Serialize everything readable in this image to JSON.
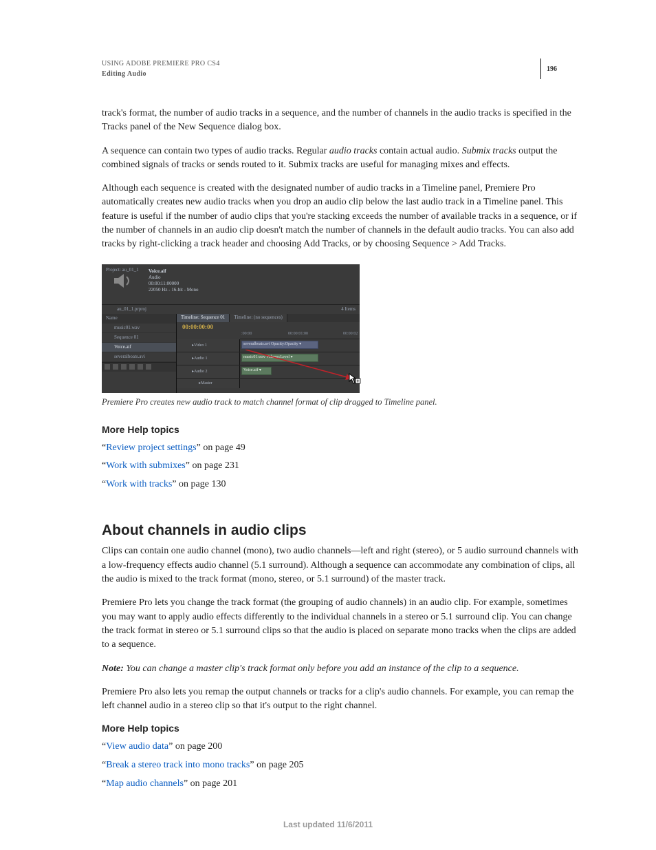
{
  "header": {
    "book_title": "USING ADOBE PREMIERE PRO CS4",
    "chapter": "Editing Audio",
    "page_number": "196"
  },
  "paragraphs": {
    "p1": "track's format, the number of audio tracks in a sequence, and the number of channels in the audio tracks is specified in the Tracks panel of the New Sequence dialog box.",
    "p2a": "A sequence can contain two types of audio tracks. Regular ",
    "p2b_i": "audio tracks",
    "p2c": " contain actual audio. ",
    "p2d_i": "Submix tracks",
    "p2e": " output the combined signals of tracks or sends routed to it. Submix tracks are useful for managing mixes and effects.",
    "p3": "Although each sequence is created with the designated number of audio tracks in a Timeline panel, Premiere Pro automatically creates new audio tracks when you drop an audio clip below the last audio track in a Timeline panel. This feature is useful if the number of audio clips that you're stacking exceeds the number of available tracks in a sequence, or if the number of channels in an audio clip doesn't match the number of channels in the default audio tracks. You can also add tracks by right-clicking a track header and choosing Add Tracks, or by choosing Sequence > Add Tracks."
  },
  "screenshot": {
    "project_label": "Project: au_01_1",
    "clip_name": "Voice.aif",
    "clip_kind": "Audio",
    "clip_duration": "00:00:11:00000",
    "clip_audio": "22050 Hz - 16-bit - Mono",
    "bin_label": "au_01_1.prproj",
    "items_label": "4 Items",
    "col_name": "Name",
    "rows": [
      "music01.wav",
      "Sequence 01",
      "Voice.aif",
      "severalboats.avi"
    ],
    "tab_seq": "Timeline: Sequence 01",
    "tab_no": "Timeline: (no sequences)",
    "timecode": "00:00:00:00",
    "tick0": ":00:00",
    "tick1": "00:00:01:00",
    "tick2": "00:00:02",
    "video1": "Video 1",
    "audio1": "Audio 1",
    "audio2": "Audio 2",
    "master": "Master",
    "clip_v": "severalboats.avi Opacity:Opacity ▾",
    "clip_a1": "music01.wav Volume:Level ▾",
    "clip_a2": "Voice.aif ▾"
  },
  "caption": "Premiere Pro creates new audio track to match channel format of clip dragged to Timeline panel.",
  "help1": {
    "heading": "More Help topics",
    "items": [
      {
        "q": "“",
        "link": "Review project settings",
        "tail": "” on page 49"
      },
      {
        "q": "“",
        "link": "Work with submixes",
        "tail": "” on page 231"
      },
      {
        "q": "“",
        "link": "Work with tracks",
        "tail": "” on page 130"
      }
    ]
  },
  "section2": {
    "heading": "About channels in audio clips",
    "p1": "Clips can contain one audio channel (mono), two audio channels—left and right (stereo), or 5 audio surround channels with a low-frequency effects audio channel (5.1 surround). Although a sequence can accommodate any combination of clips, all the audio is mixed to the track format (mono, stereo, or 5.1 surround) of the master track.",
    "p2": "Premiere Pro lets you change the track format (the grouping of audio channels) in an audio clip. For example, sometimes you may want to apply audio effects differently to the individual channels in a stereo or 5.1 surround clip. You can change the track format in stereo or 5.1 surround clips so that the audio is placed on separate mono tracks when the clips are added to a sequence.",
    "note_lead": "Note:",
    "note_body": " You can change a master clip's track format only before you add an instance of the clip to a sequence.",
    "p3": "Premiere Pro also lets you remap the output channels or tracks for a clip's audio channels. For example, you can remap the left channel audio in a stereo clip so that it's output to the right channel."
  },
  "help2": {
    "heading": "More Help topics",
    "items": [
      {
        "q": "“",
        "link": "View audio data",
        "tail": "” on page 200"
      },
      {
        "q": "“",
        "link": "Break a stereo track into mono tracks",
        "tail": "” on page 205"
      },
      {
        "q": "“",
        "link": "Map audio channels",
        "tail": "” on page 201"
      }
    ]
  },
  "footer": "Last updated 11/6/2011"
}
